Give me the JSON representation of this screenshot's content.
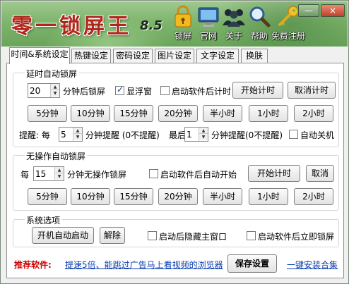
{
  "header": {
    "title": "零一锁屏王",
    "version": "8.5",
    "buttons": [
      {
        "label": "锁屏",
        "icon": "padlock-icon"
      },
      {
        "label": "官网",
        "icon": "monitor-icon"
      },
      {
        "label": "关于",
        "icon": "people-icon"
      },
      {
        "label": "帮助",
        "icon": "magnifier-icon"
      },
      {
        "label": "免费注册",
        "icon": "key-icon"
      }
    ],
    "minimize": "—",
    "close": "×"
  },
  "tabs": [
    "时间&系统设定",
    "热键设定",
    "密码设定",
    "图片设定",
    "文字设定",
    "换肤"
  ],
  "active_tab": 0,
  "group_timed": {
    "title": "延时自动锁屏",
    "minutes_value": "20",
    "minutes_suffix": "分钟后锁屏",
    "show_float_label": "显浮窗",
    "show_float_checked": true,
    "timer_on_start_label": "启动软件后计时",
    "timer_on_start_checked": false,
    "start_timer": "开始计时",
    "cancel_timer": "取消计时",
    "presets": [
      "5分钟",
      "10分钟",
      "15分钟",
      "20分钟",
      "半小时",
      "1小时",
      "2小时"
    ],
    "remind_prefix": "提醒: 每",
    "remind_every_value": "5",
    "remind_every_suffix": "分钟提醒 (0不提醒)",
    "remind_last_prefix": "最后",
    "remind_last_value": "1",
    "remind_last_suffix": "分钟提醒(0不提醒)",
    "auto_shutdown_label": "自动关机",
    "auto_shutdown_checked": false
  },
  "group_idle": {
    "title": "无操作自动锁屏",
    "prefix": "每",
    "minutes_value": "15",
    "minutes_suffix": "分钟无操作锁屏",
    "auto_start_label": "启动软件后自动开始",
    "auto_start_checked": false,
    "start_timer": "开始计时",
    "cancel": "取消",
    "presets": [
      "5分钟",
      "10分钟",
      "15分钟",
      "20分钟",
      "半小时",
      "1小时",
      "2小时"
    ]
  },
  "group_system": {
    "title": "系统选项",
    "autostart": "开机自动启动",
    "remove": "解除",
    "hide_main_label": "启动后隐藏主窗口",
    "hide_main_checked": false,
    "lock_immediately_label": "启动软件后立即锁屏",
    "lock_immediately_checked": false
  },
  "footer": {
    "recommend_label": "推荐软件:",
    "recommend_link": "提速5倍、能跳过广告马上看视频的浏览器",
    "save": "保存设置",
    "install": "一键安装合集"
  },
  "colors": {
    "title_red": "#b0261a",
    "recommend_red": "#cc0000",
    "link_blue": "#0b3fb0",
    "header_green": "#7fb56d"
  }
}
